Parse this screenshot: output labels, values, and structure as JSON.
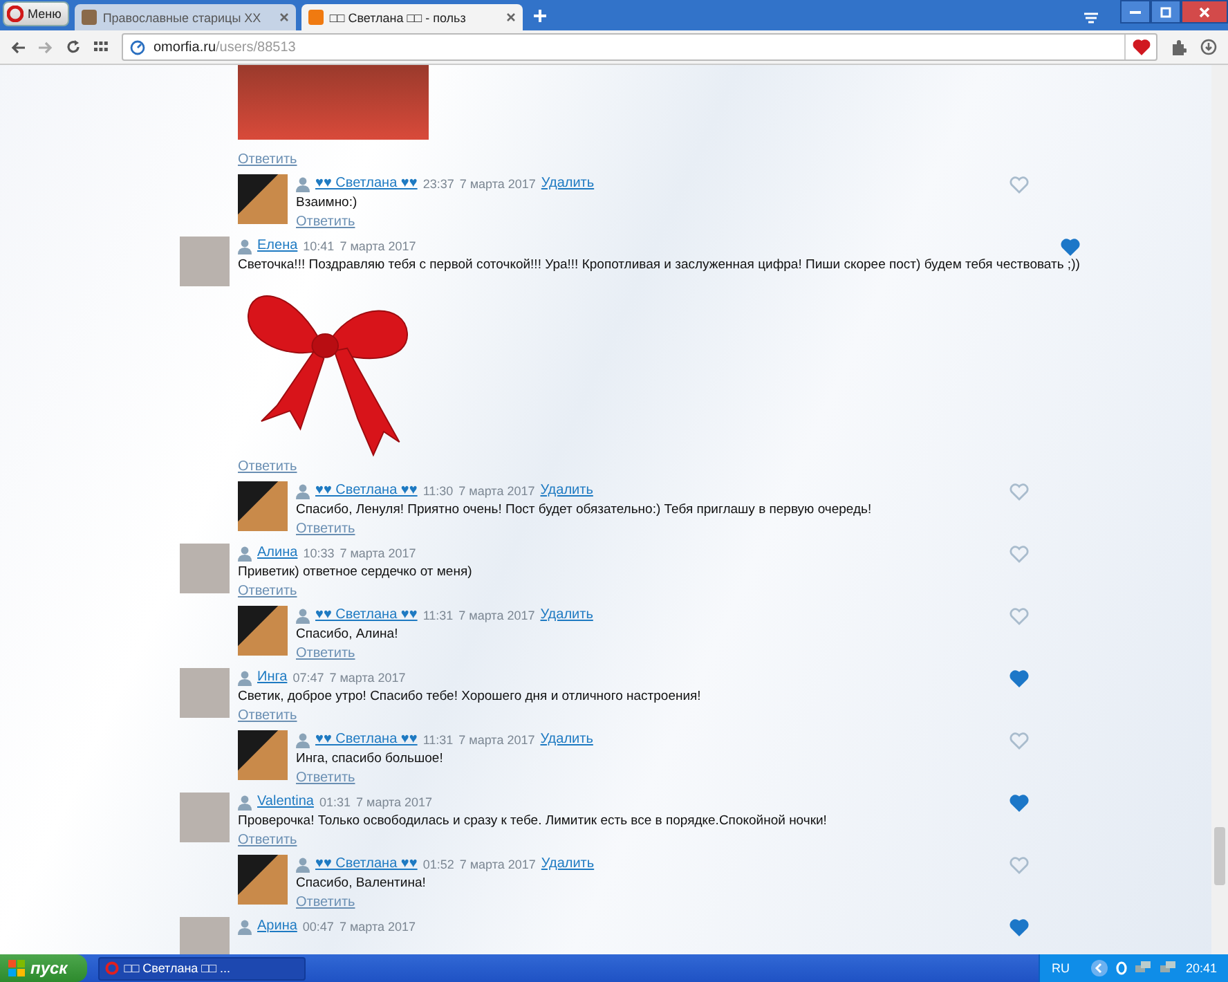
{
  "browser": {
    "menu_button": "Меню",
    "tabs": [
      {
        "title": "Православные старицы XX",
        "selected": false
      },
      {
        "title": "□□ Светлана □□ - польз",
        "selected": true
      }
    ],
    "address": {
      "host": "omorfia.ru",
      "path": "/users/88513"
    },
    "bookmarked": true
  },
  "comments": [
    {
      "kind": "fragment",
      "reply_link": "Ответить"
    },
    {
      "kind": "reply",
      "author": "♥♥ Светлана ♥♥",
      "time": "23:37",
      "date": "7 марта 2017",
      "delete_link": "Удалить",
      "text": "Взаимно:)",
      "reply_link": "Ответить",
      "liked": false
    },
    {
      "kind": "gift",
      "author": "Елена",
      "time": "10:41",
      "date": "7 марта 2017",
      "text": "Светочка!!! Поздравляю тебя с первой соточкой!!! Ура!!! Кропотливая и заслуженная цифра! Пиши скорее пост) будем тебя чествовать ;))",
      "reply_link": "Ответить",
      "liked": true
    },
    {
      "kind": "reply",
      "author": "♥♥ Светлана ♥♥",
      "time": "11:30",
      "date": "7 марта 2017",
      "delete_link": "Удалить",
      "text": "Спасибо, Ленуля! Приятно очень! Пост будет обязательно:) Тебя приглашу в первую очередь!",
      "reply_link": "Ответить",
      "liked": false
    },
    {
      "kind": "comment",
      "author": "Алина",
      "time": "10:33",
      "date": "7 марта 2017",
      "text": "Приветик) ответное сердечко от меня)",
      "reply_link": "Ответить",
      "liked": false
    },
    {
      "kind": "reply",
      "author": "♥♥ Светлана ♥♥",
      "time": "11:31",
      "date": "7 марта 2017",
      "delete_link": "Удалить",
      "text": "Спасибо, Алина!",
      "reply_link": "Ответить",
      "liked": false
    },
    {
      "kind": "comment",
      "author": "Инга",
      "time": "07:47",
      "date": "7 марта 2017",
      "text": "Светик, доброе утро! Спасибо тебе! Хорошего дня и отличного настроения!",
      "reply_link": "Ответить",
      "liked": true
    },
    {
      "kind": "reply",
      "author": "♥♥ Светлана ♥♥",
      "time": "11:31",
      "date": "7 марта 2017",
      "delete_link": "Удалить",
      "text": "Инга, спасибо большое!",
      "reply_link": "Ответить",
      "liked": false
    },
    {
      "kind": "comment",
      "author": "Valentina",
      "time": "01:31",
      "date": "7 марта 2017",
      "text": "Проверочка! Только освободилась и сразу к тебе. Лимитик есть все в порядке.Спокойной ночки!",
      "reply_link": "Ответить",
      "liked": true
    },
    {
      "kind": "reply",
      "author": "♥♥ Светлана ♥♥",
      "time": "01:52",
      "date": "7 марта 2017",
      "delete_link": "Удалить",
      "text": "Спасибо, Валентина!",
      "reply_link": "Ответить",
      "liked": false
    },
    {
      "kind": "comment",
      "author": "Арина",
      "time": "00:47",
      "date": "7 марта 2017",
      "liked": true
    }
  ],
  "taskbar": {
    "start_button": "пуск",
    "tasks": [
      {
        "title": "□□ Светлана □□ ...",
        "selected": true
      }
    ],
    "language": "RU",
    "clock": "20:41"
  }
}
